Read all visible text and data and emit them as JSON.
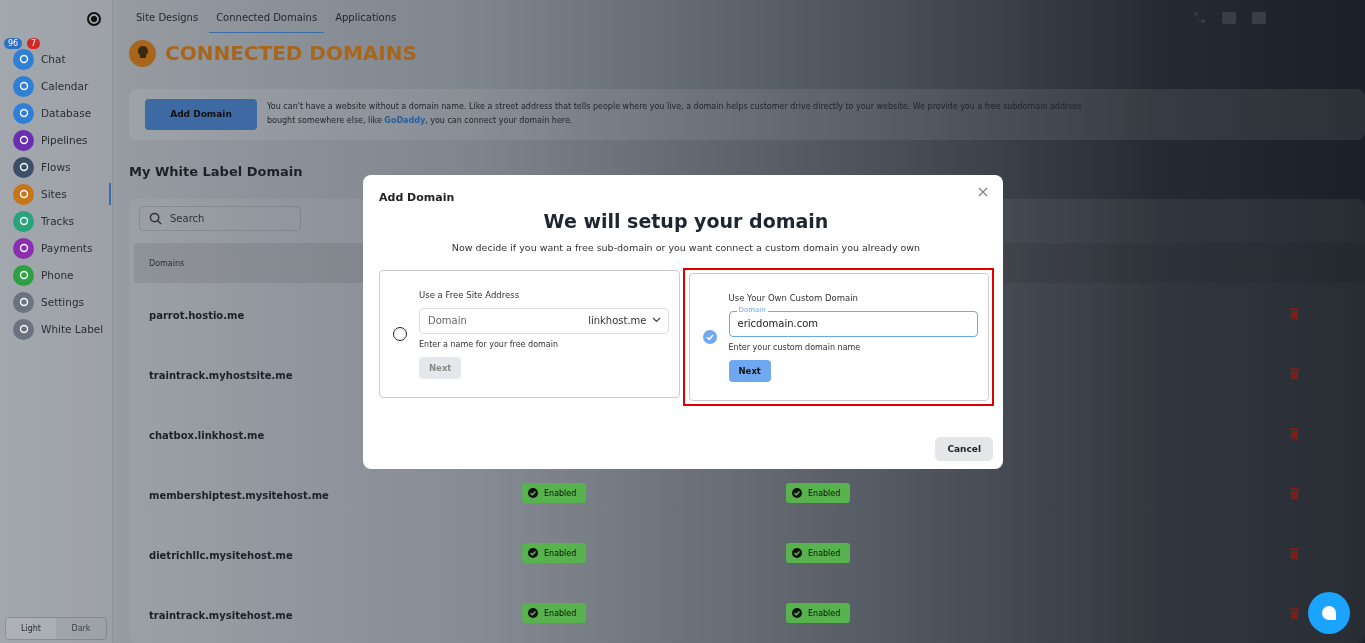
{
  "sidebar": {
    "badges": [
      "96",
      "7"
    ],
    "items": [
      {
        "label": "Chat",
        "color": "#2f7fd6",
        "selected": false
      },
      {
        "label": "Calendar",
        "color": "#2f7fd6",
        "selected": false
      },
      {
        "label": "Database",
        "color": "#2f7fd6",
        "selected": false
      },
      {
        "label": "Pipelines",
        "color": "#6a2fb0",
        "selected": false
      },
      {
        "label": "Flows",
        "color": "#3b4f66",
        "selected": false
      },
      {
        "label": "Sites",
        "color": "#c8751a",
        "selected": true
      },
      {
        "label": "Tracks",
        "color": "#2aa37a",
        "selected": false
      },
      {
        "label": "Payments",
        "color": "#8a2fb0",
        "selected": false
      },
      {
        "label": "Phone",
        "color": "#2ea043",
        "selected": false
      },
      {
        "label": "Settings",
        "color": "#6b7280",
        "selected": false
      },
      {
        "label": "White Label",
        "color": "#6b7280",
        "selected": false
      }
    ],
    "theme": [
      {
        "label": "Light",
        "selected": true
      },
      {
        "label": "Dark",
        "selected": false
      }
    ]
  },
  "tabs": [
    {
      "label": "Site Designs",
      "selected": false
    },
    {
      "label": "Connected Domains",
      "selected": true
    },
    {
      "label": "Applications",
      "selected": false
    }
  ],
  "page_title": "CONNECTED DOMAINS",
  "info": {
    "button": "Add Domain",
    "line_1": "You can't have a website without a domain name. Like a street address that tells people where you live, a domain helps customer drive directly to your website. We provide you a free subdomain address",
    "line_2_before": "bought somewhere else, like ",
    "link": "GoDaddy",
    "line_2_after": ", you can connect your domain here."
  },
  "section_title": "My White Label Domain",
  "search": {
    "placeholder": "Search"
  },
  "table": {
    "columns": [
      "Domains"
    ],
    "rows": [
      {
        "domain": "parrot.hostio.me"
      },
      {
        "domain": "traintrack.myhostsite.me"
      },
      {
        "domain": "chatbox.linkhost.me"
      },
      {
        "domain": "membershiptest.mysitehost.me",
        "status_1": "Enabled",
        "status_2": "Enabled"
      },
      {
        "domain": "dietrichllc.mysitehost.me",
        "status_1": "Enabled",
        "status_2": "Enabled"
      },
      {
        "domain": "traintrack.mysitehost.me",
        "status_1": "Enabled",
        "status_2": "Enabled"
      }
    ]
  },
  "modal": {
    "header": "Add Domain",
    "title": "We will setup your domain",
    "subtitle": "Now decide if you want a free sub-domain or you want connect a custom domain you already own",
    "options": [
      {
        "kind": "free",
        "selected": false,
        "highlighted": false,
        "label": "Use a Free Site Address",
        "placeholder": "Domain",
        "suffix": "linkhost.me",
        "hint": "Enter a name for your free domain",
        "button": "Next",
        "disabled": true
      },
      {
        "kind": "custom",
        "selected": true,
        "highlighted": true,
        "label": "Use Your Own Custom Domain",
        "field_label": "Domain",
        "value": "ericdomain.com",
        "hint": "Enter your custom domain name",
        "button": "Next",
        "disabled": false
      }
    ],
    "cancel": "Cancel"
  }
}
